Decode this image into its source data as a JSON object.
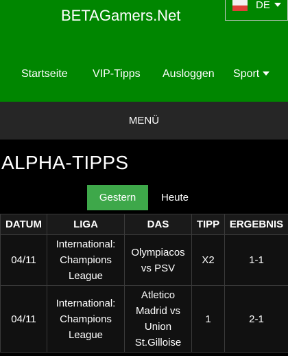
{
  "header": {
    "site_title": "BETAGamers.Net",
    "language": {
      "code": "DE",
      "icon": "german-flag-icon"
    },
    "nav": [
      {
        "label": "Startseite"
      },
      {
        "label": "VIP-Tipps"
      },
      {
        "label": "Ausloggen"
      },
      {
        "label": "Sport",
        "icon": "caret-down-icon"
      }
    ]
  },
  "menu": {
    "label": "MENÜ"
  },
  "page": {
    "title": "ALPHA-TIPPS"
  },
  "tabs": [
    {
      "label": "Gestern",
      "active": true
    },
    {
      "label": "Heute",
      "active": false
    }
  ],
  "table": {
    "headers": [
      "DATUM",
      "LIGA",
      "DAS",
      "TIPP",
      "ERGEBNIS"
    ],
    "rows": [
      {
        "date": "04/11",
        "league": "International: Champions League",
        "match": "Olympiacos vs PSV",
        "tip": "X2",
        "result": "1-1"
      },
      {
        "date": "04/11",
        "league": "International: Champions League",
        "match": "Atletico Madrid vs Union St.Gilloise",
        "tip": "1",
        "result": "2-1"
      }
    ]
  },
  "colors": {
    "header_bg": "#008600",
    "menu_bg": "#262626",
    "active_tab": "#3ea84a",
    "page_bg": "#000000"
  }
}
